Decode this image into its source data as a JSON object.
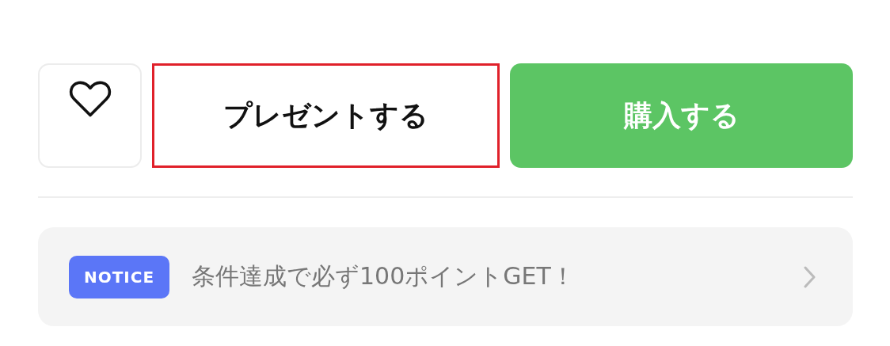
{
  "actions": {
    "favorite": {
      "liked": false
    },
    "present_button": {
      "label": "プレゼントする",
      "highlighted": true
    },
    "buy_button": {
      "label": "購入する"
    }
  },
  "notice": {
    "badge": "NOTICE",
    "text": "条件達成で必ず100ポイントGET！"
  }
}
